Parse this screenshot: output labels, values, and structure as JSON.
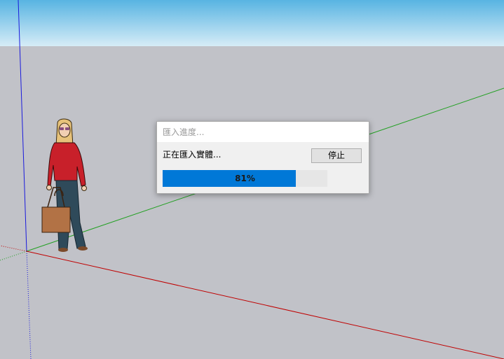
{
  "dialog": {
    "title": "匯入進度...",
    "status_text": "正在匯入實體...",
    "stop_label": "停止",
    "progress_percent": 81,
    "progress_label": "81%"
  },
  "colors": {
    "sky_top": "#58b4e2",
    "ground": "#c1c2c8",
    "progress_fill": "#0078d7",
    "axis_red": "#c00000",
    "axis_green": "#22a022",
    "axis_blue": "#1a1adc"
  },
  "icons": {
    "scale_figure": "person-with-handbag"
  }
}
